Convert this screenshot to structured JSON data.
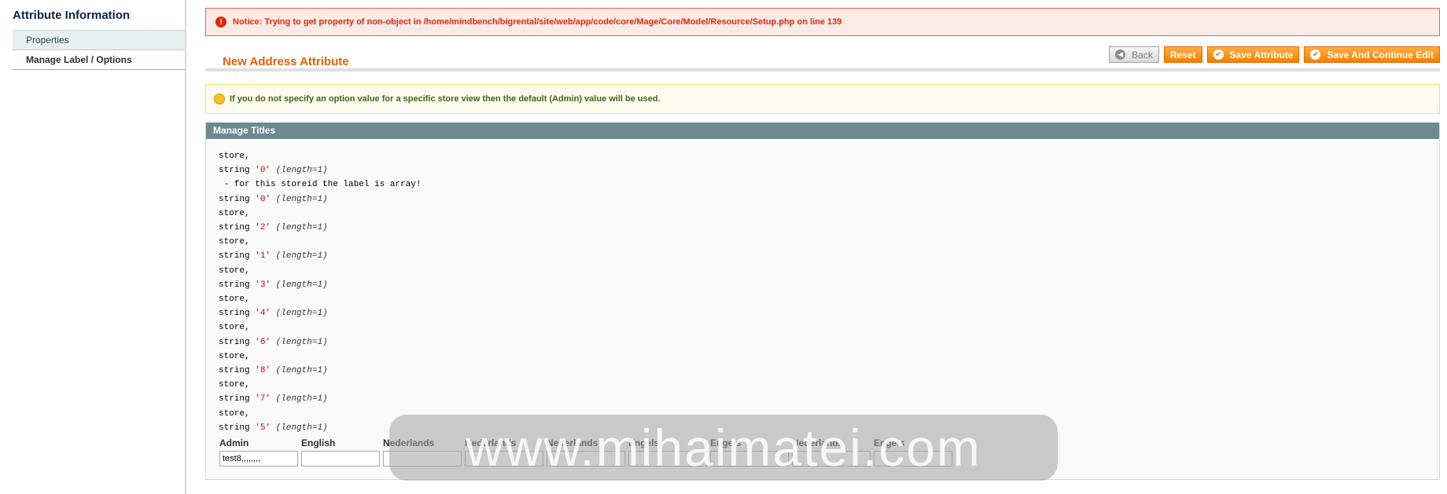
{
  "sidebar": {
    "title": "Attribute Information",
    "tabs": [
      {
        "label": "Properties"
      },
      {
        "label": "Manage Label / Options"
      }
    ]
  },
  "notice": {
    "text": "Notice: Trying to get property of non-object in /home/mindbench/bigrental/site/web/app/code/core/Mage/Core/Model/Resource/Setup.php on line 139"
  },
  "header": {
    "title": "New Address Attribute",
    "buttons": {
      "back": "Back",
      "reset": "Reset",
      "save": "Save Attribute",
      "save_continue": "Save And Continue Edit"
    }
  },
  "hint": {
    "text": "If you do not specify an option value for a specific store view then the default (Admin) value will be used."
  },
  "manage_titles": {
    "heading": "Manage Titles",
    "dump": {
      "store": "store,",
      "string": "string",
      "length": "(length=1)",
      "array_note": " - for this storeid the label is array!",
      "v0": "'0'",
      "v2": "'2'",
      "v1": "'1'",
      "v3": "'3'",
      "v4": "'4'",
      "v6": "'6'",
      "v8": "'8'",
      "v7": "'7'",
      "v5": "'5'"
    },
    "columns": [
      {
        "label": "Admin",
        "value": "test8,,,,,,,,"
      },
      {
        "label": "English",
        "value": ""
      },
      {
        "label": "Nederlands",
        "value": ""
      },
      {
        "label": "Nederlands",
        "value": ""
      },
      {
        "label": "Nederlands",
        "value": ""
      },
      {
        "label": "Engels",
        "value": ""
      },
      {
        "label": "Engels",
        "value": ""
      },
      {
        "label": "Nederlands",
        "value": ""
      },
      {
        "label": "Engels",
        "value": ""
      }
    ]
  },
  "watermark": {
    "text": "www.mihaimatei.com"
  },
  "colors": {
    "accent": "#eb5e00",
    "button": "#f18200",
    "error": "#df280a",
    "hint": "#3d6611",
    "section_header": "#6f8992"
  },
  "icons": {
    "error": "error-icon",
    "back": "arrow-left-icon",
    "save": "check-icon",
    "hint": "lightbulb-icon"
  }
}
